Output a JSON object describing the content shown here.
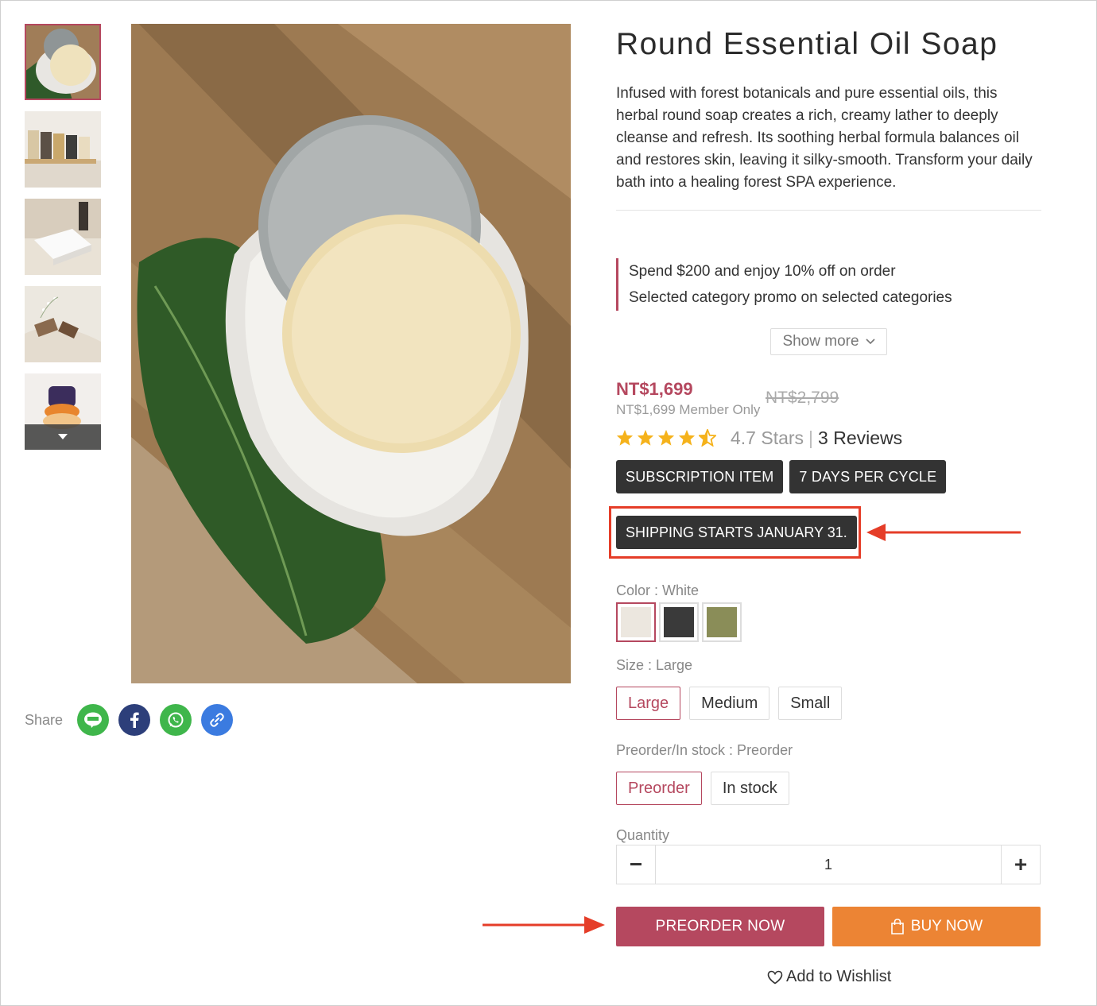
{
  "product": {
    "title": "Round Essential Oil Soap",
    "description": "Infused with forest botanicals and pure essential oils, this herbal round soap creates a rich, creamy lather to deeply cleanse and refresh. Its soothing herbal formula balances oil and restores skin, leaving it silky-smooth. Transform your daily bath into a healing forest SPA experience."
  },
  "promotions": [
    "Spend $200 and enjoy 10% off on order",
    "Selected category promo on selected categories"
  ],
  "show_more_label": "Show more",
  "price": {
    "current": "NT$1,699",
    "member_note": "NT$1,699 Member Only",
    "original": "NT$2,799"
  },
  "rating": {
    "stars": 4.7,
    "text": "4.7 Stars",
    "separator": "|",
    "reviews": "3 Reviews"
  },
  "tags": [
    "SUBSCRIPTION ITEM",
    "7 DAYS PER CYCLE"
  ],
  "shipping_tag": "SHIPPING STARTS JANUARY 31.",
  "color": {
    "label": "Color : White",
    "swatches": [
      {
        "name": "White",
        "hex": "#ece7df",
        "selected": true
      },
      {
        "name": "Black",
        "hex": "#3a3a3a",
        "selected": false
      },
      {
        "name": "Green",
        "hex": "#8a8d58",
        "selected": false
      }
    ]
  },
  "size": {
    "label": "Size : Large",
    "options": [
      "Large",
      "Medium",
      "Small"
    ],
    "selected": "Large"
  },
  "stock": {
    "label": "Preorder/In stock : Preorder",
    "options": [
      "Preorder",
      "In stock"
    ],
    "selected": "Preorder"
  },
  "quantity": {
    "label": "Quantity",
    "value": "1",
    "minus": "−",
    "plus": "+"
  },
  "buttons": {
    "preorder": "PREORDER NOW",
    "buy": "BUY NOW",
    "wishlist": "Add to Wishlist"
  },
  "share": {
    "label": "Share",
    "icons": [
      "line-icon",
      "facebook-icon",
      "whatsapp-icon",
      "link-icon"
    ]
  },
  "colors": {
    "accent": "#b5485f",
    "buy": "#ec8434",
    "annotation": "#e53d28"
  }
}
